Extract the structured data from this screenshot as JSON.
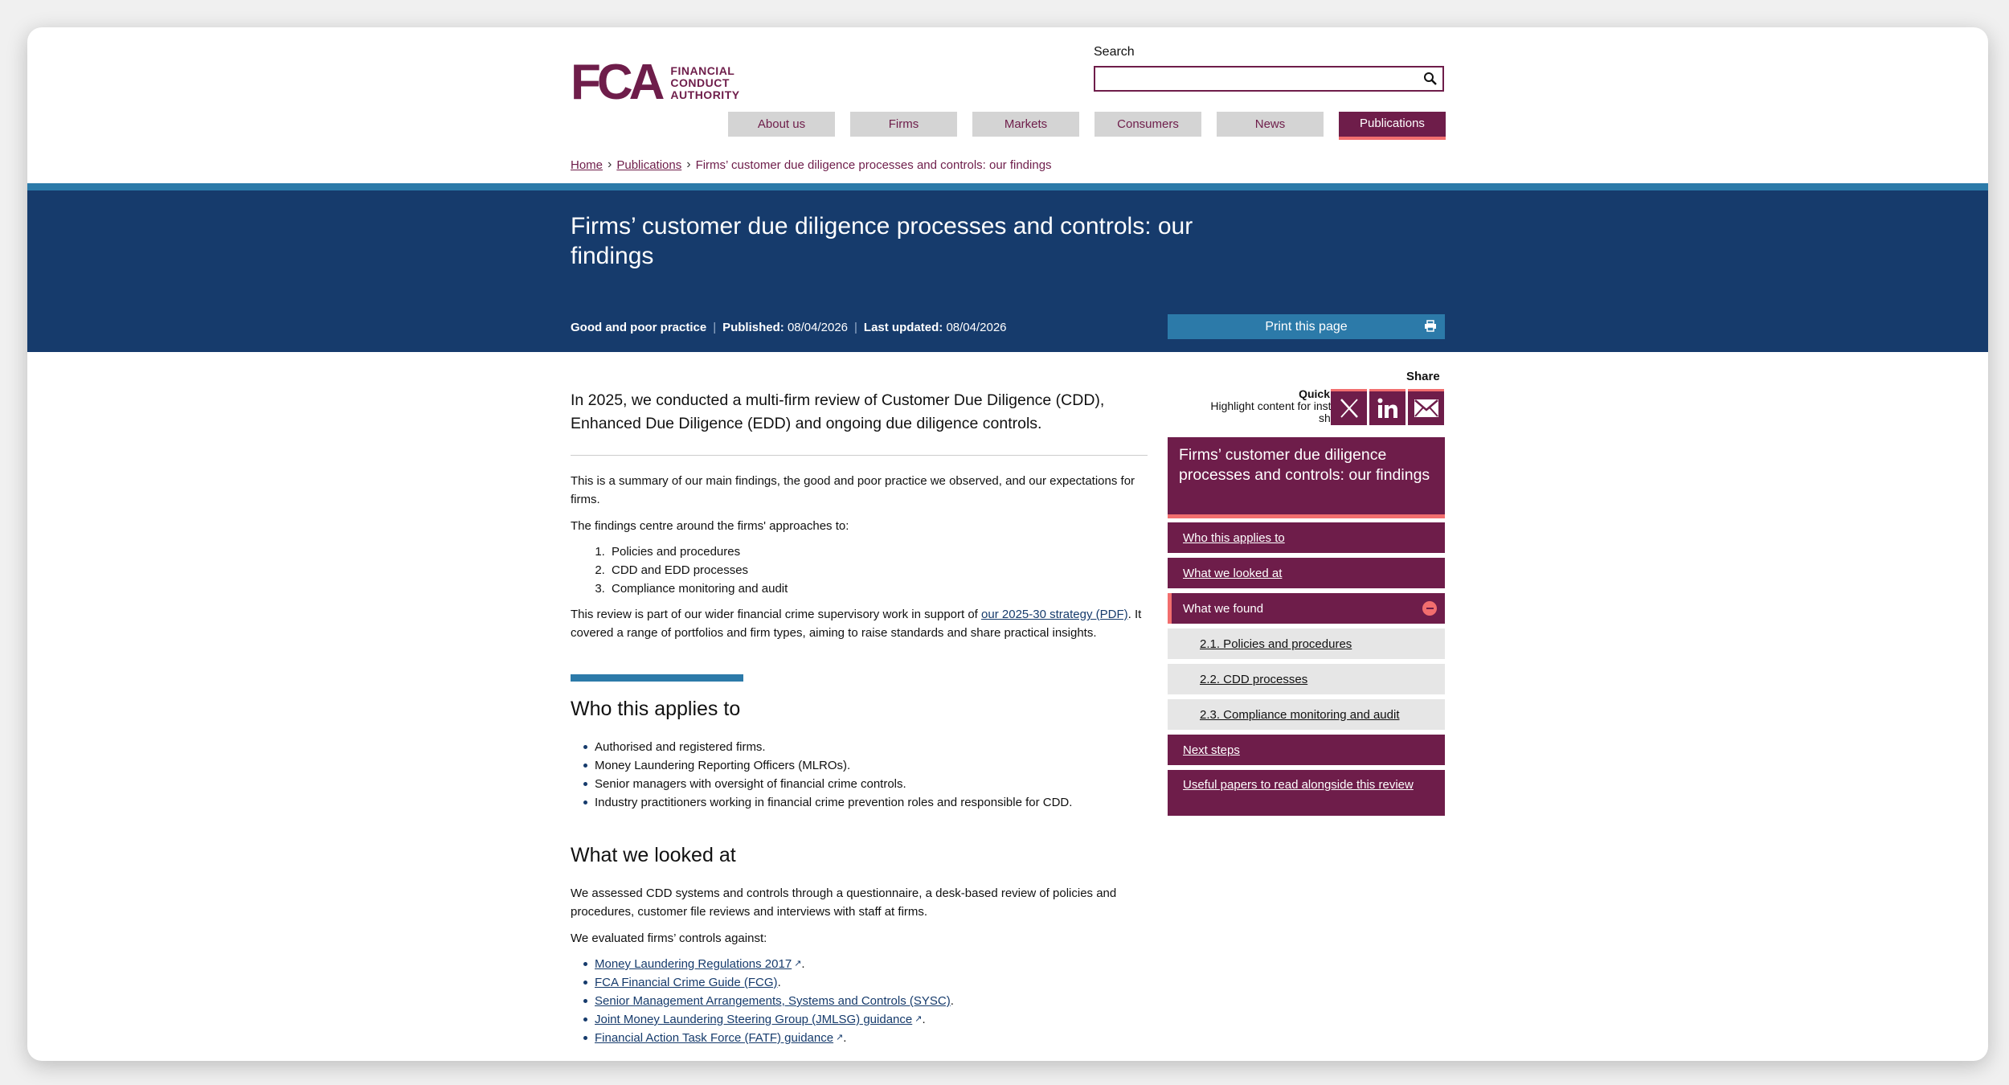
{
  "header": {
    "logo_letters": "FCA",
    "logo_words": [
      "FINANCIAL",
      "CONDUCT",
      "AUTHORITY"
    ],
    "search_label": "Search",
    "search_value": "",
    "search_icon": "magnifier-icon"
  },
  "nav": {
    "items": [
      {
        "label": "About us"
      },
      {
        "label": "Firms"
      },
      {
        "label": "Markets"
      },
      {
        "label": "Consumers"
      },
      {
        "label": "News"
      },
      {
        "label": "Publications",
        "active": true
      }
    ]
  },
  "breadcrumb": {
    "home": "Home",
    "publications": "Publications",
    "current": "Firms’ customer due diligence processes and controls: our findings"
  },
  "hero": {
    "title": "Firms’ customer due diligence processes and controls: our findings",
    "type": "Good and poor practice",
    "published_label": "Published:",
    "published": "08/04/2026",
    "updated_label": "Last updated:",
    "updated": "08/04/2026",
    "print_label": "Print this page"
  },
  "colors": {
    "brand_purple": "#6e1d4a",
    "hero_blue": "#163b6c",
    "accent_blue": "#2c7aa9",
    "accent_coral": "#f26e6e"
  },
  "article": {
    "lead": "In 2025, we conducted a multi-firm review of Customer Due Diligence (CDD), Enhanced Due Diligence (EDD) and ongoing due diligence controls.",
    "p1": "This is a summary of our main findings, the good and poor practice we observed, and our expectations for firms.",
    "p2": "The findings centre around the firms' approaches to:",
    "approaches": [
      "Policies and procedures",
      "CDD and EDD processes",
      "Compliance monitoring and audit"
    ],
    "p3_before": "This review is part of our wider financial crime supervisory work in support of ",
    "p3_link": "our 2025-30 strategy (PDF)",
    "p3_after": ". It covered a range of portfolios and firm types, aiming to raise standards and share practical insights.",
    "h_applies": "Who this applies to",
    "applies": [
      "Authorised and registered firms.",
      "Money Laundering Reporting Officers (MLROs).",
      "Senior managers with oversight of financial crime controls.",
      "Industry practitioners working in financial crime prevention roles and responsible for CDD."
    ],
    "h_looked": "What we looked at",
    "p4": "We assessed CDD systems and controls through a questionnaire, a desk-based review of policies and procedures, customer file reviews and interviews with staff at firms.",
    "p5": "We evaluated firms’ controls against:",
    "refs": [
      {
        "text": "Money Laundering Regulations 2017",
        "external": true
      },
      {
        "text": "FCA Financial Crime Guide (FCG)",
        "external": false
      },
      {
        "text": "Senior Management Arrangements, Systems and Controls (SYSC)",
        "external": false
      },
      {
        "text": "Joint Money Laundering Steering Group (JMLSG) guidance",
        "external": true
      },
      {
        "text": "Financial Action Task Force (FATF) guidance",
        "external": true
      }
    ],
    "ref_suffix": "."
  },
  "sidebar": {
    "share_label": "Share",
    "quicktip_title": "Quick tip",
    "quicktip_text": "Highlight content for instant share",
    "share_buttons": [
      "x-icon",
      "linkedin-icon",
      "email-icon"
    ],
    "toc_title": "Firms’ customer due diligence processes and controls: our findings",
    "toc": {
      "who": "Who this applies to",
      "looked": "What we looked at",
      "found": "What we found",
      "sub1": "2.1. Policies and procedures",
      "sub2": "2.2. CDD processes",
      "sub3": "2.3. Compliance monitoring and audit",
      "next": "Next steps",
      "papers": "Useful papers to read alongside this review"
    }
  }
}
